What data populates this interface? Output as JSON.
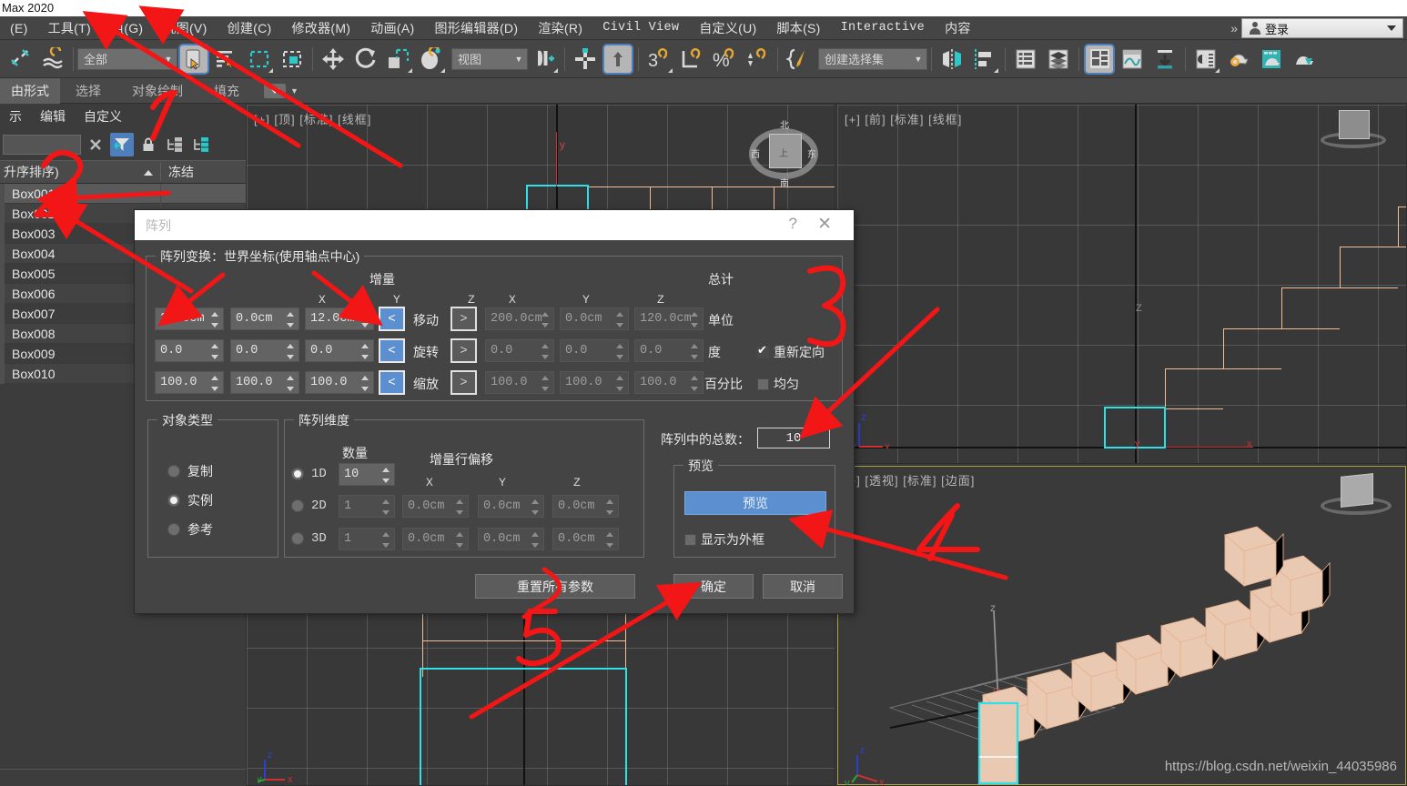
{
  "window": {
    "title": "Max 2020"
  },
  "menubar": {
    "items": [
      {
        "label": "(E)"
      },
      {
        "label": "工具(T)"
      },
      {
        "label": "组(G)"
      },
      {
        "label": "视图(V)"
      },
      {
        "label": "创建(C)"
      },
      {
        "label": "修改器(M)"
      },
      {
        "label": "动画(A)"
      },
      {
        "label": "图形编辑器(D)"
      },
      {
        "label": "渲染(R)"
      },
      {
        "label": "Civil View",
        "mono": true
      },
      {
        "label": "自定义(U)"
      },
      {
        "label": "脚本(S)"
      },
      {
        "label": "Interactive",
        "mono": true
      },
      {
        "label": "内容"
      }
    ],
    "overflow": "»",
    "login_label": "登录"
  },
  "toolbar": {
    "selection_filter": "全部",
    "reference_coord": "视图",
    "named_selection_sets": "创建选择集",
    "icons": [
      "link-icon",
      "unlink-icon",
      "select-object-icon",
      "select-by-name-icon",
      "rectangle-select-icon",
      "window-crossing-icon",
      "select-move-icon",
      "select-rotate-icon",
      "select-scale-icon",
      "select-place-icon",
      "use-pivot-center-icon",
      "use-selection-center-icon",
      "snap-toggle-icon",
      "snaps-3d-icon",
      "angle-snap-icon",
      "percent-snap-icon",
      "spinner-snap-icon",
      "edit-named-selection-icon",
      "mirror-icon",
      "align-icon",
      "layer-explorer-icon",
      "scene-explorer-icon",
      "curve-editor-icon",
      "schematic-view-icon",
      "material-editor-icon",
      "render-setup-icon",
      "rendered-frame-icon",
      "render-production-icon"
    ]
  },
  "ribbon": {
    "active_tab": "由形式",
    "tabs": [
      "选择",
      "对象绘制",
      "填充"
    ],
    "dropdown_icon": "fill-dropdown-icon"
  },
  "explorer": {
    "menu": [
      "示",
      "编辑",
      "自定义"
    ],
    "search_value": "",
    "tool_icons": [
      "clear-icon",
      "filter-icon",
      "lock-icon",
      "collapse-all-icon",
      "expand-all-icon"
    ],
    "columns": {
      "name": "升序排序)",
      "frozen": "冻结"
    },
    "items": [
      {
        "name": "Box001",
        "selected": true
      },
      {
        "name": "Box002",
        "selected": false
      },
      {
        "name": "Box003",
        "selected": false
      },
      {
        "name": "Box004",
        "selected": false
      },
      {
        "name": "Box005",
        "selected": false
      },
      {
        "name": "Box006",
        "selected": false
      },
      {
        "name": "Box007",
        "selected": false
      },
      {
        "name": "Box008",
        "selected": false
      },
      {
        "name": "Box009",
        "selected": false
      },
      {
        "name": "Box010",
        "selected": false
      }
    ]
  },
  "viewports": {
    "top_left": {
      "label": "[+] [顶] [标准] [线框]"
    },
    "bottom_left": {
      "label": ""
    },
    "top_right": {
      "label": "[+] [前] [标准] [线框]"
    },
    "bottom_right": {
      "label": "[+] [透视] [标准] [边面]"
    },
    "axis_labels": {
      "x": "X",
      "y": "Y",
      "z": "Z",
      "xl": "x",
      "yl": "y",
      "zl": "z"
    },
    "compass": {
      "n": "北",
      "s": "南",
      "e": "东",
      "w": "西",
      "center": "上"
    }
  },
  "array_dialog": {
    "title": "阵列",
    "help_icon": "?",
    "close_icon": "✕",
    "transform_group": "阵列变换：世界坐标(使用轴点中心)",
    "incremental_header": "增量",
    "totals_header": "总计",
    "axis_headers": [
      "X",
      "Y",
      "Z"
    ],
    "rows": [
      {
        "name": "移动",
        "unit_label": "单位",
        "incremental": [
          "20.0cm",
          "0.0cm",
          "12.0cm"
        ],
        "totals": [
          "200.0cm",
          "0.0cm",
          "120.0cm"
        ],
        "left_arrow": "<",
        "right_arrow": ">"
      },
      {
        "name": "旋转",
        "unit_label": "度",
        "incremental": [
          "0.0",
          "0.0",
          "0.0"
        ],
        "totals": [
          "0.0",
          "0.0",
          "0.0"
        ],
        "left_arrow": "<",
        "right_arrow": ">"
      },
      {
        "name": "缩放",
        "unit_label": "百分比",
        "incremental": [
          "100.0",
          "100.0",
          "100.0"
        ],
        "totals": [
          "100.0",
          "100.0",
          "100.0"
        ],
        "left_arrow": "<",
        "right_arrow": ">"
      }
    ],
    "reorient": {
      "label": "重新定向",
      "checked": true
    },
    "uniform": {
      "label": "均匀",
      "checked": false
    },
    "object_type": {
      "group_label": "对象类型",
      "options": [
        {
          "label": "复制",
          "selected": false
        },
        {
          "label": "实例",
          "selected": true
        },
        {
          "label": "参考",
          "selected": false
        }
      ]
    },
    "array_dimensions": {
      "group_label": "阵列维度",
      "count_header": "数量",
      "offset_header": "增量行偏移",
      "axis_headers": [
        "X",
        "Y",
        "Z"
      ],
      "rows": [
        {
          "dim": "1D",
          "selected": true,
          "count": "10",
          "offsets": [
            "",
            "",
            ""
          ],
          "enabled": true
        },
        {
          "dim": "2D",
          "selected": false,
          "count": "1",
          "offsets": [
            "0.0cm",
            "0.0cm",
            "0.0cm"
          ],
          "enabled": false
        },
        {
          "dim": "3D",
          "selected": false,
          "count": "1",
          "offsets": [
            "0.0cm",
            "0.0cm",
            "0.0cm"
          ],
          "enabled": false
        }
      ]
    },
    "total_in_array": {
      "label": "阵列中的总数：",
      "value": "10"
    },
    "preview": {
      "group_label": "预览",
      "button_label": "预览",
      "display_as_box": {
        "label": "显示为外框",
        "checked": false
      }
    },
    "buttons": {
      "reset_all": "重置所有参数",
      "ok": "确定",
      "cancel": "取消"
    }
  },
  "annotations": {
    "numbers": [
      "1",
      "2",
      "3",
      "4",
      "5"
    ],
    "color": "#f21616"
  },
  "watermark": "https://blog.csdn.net/weixin_44035986",
  "colors": {
    "accent_blue": "#5b8fd0",
    "panel_bg": "#444444",
    "toolbar_bg": "#454545",
    "viewport_bg": "#383838",
    "selection_cyan": "#2ee0e8",
    "object_orange": "#f0bd97",
    "annotation_red": "#f21616"
  }
}
